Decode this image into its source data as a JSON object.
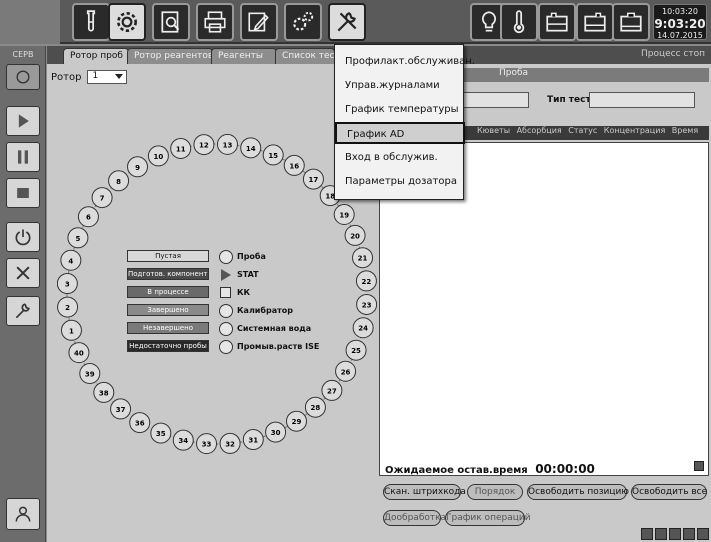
{
  "clock": {
    "top": "10:03:20",
    "time": "9:03:20",
    "date": "14.07.2015"
  },
  "sidebar": {
    "top_label": "СЕРВ"
  },
  "tabs": [
    {
      "label": "Ротор проб"
    },
    {
      "label": "Ротор реагентов"
    },
    {
      "label": "Реагенты"
    },
    {
      "label": "Список тестов"
    }
  ],
  "tab_right_text": "Процесс стоп",
  "rotor": {
    "label": "Ротор",
    "selected": "1"
  },
  "positions": [
    "1",
    "2",
    "3",
    "4",
    "5",
    "6",
    "7",
    "8",
    "9",
    "10",
    "11",
    "12",
    "13",
    "14",
    "15",
    "16",
    "17",
    "18",
    "19",
    "20",
    "21",
    "22",
    "23",
    "24",
    "25",
    "26",
    "27",
    "28",
    "29",
    "30",
    "31",
    "32",
    "33",
    "34",
    "35",
    "36",
    "37",
    "38",
    "39",
    "40"
  ],
  "status_legend": [
    {
      "label": "Пустая",
      "color": "#d8d8d8",
      "text_color": "#111"
    },
    {
      "label": "Подготов. компоненты",
      "color": "#4a4a4a",
      "text_color": "#fff"
    },
    {
      "label": "В процессе",
      "color": "#6a6a6a",
      "text_color": "#fff"
    },
    {
      "label": "Завершено",
      "color": "#8a8a8a",
      "text_color": "#fff"
    },
    {
      "label": "Незавершено",
      "color": "#7a7a7a",
      "text_color": "#fff"
    },
    {
      "label": "Недостаточно пробы",
      "color": "#2a2a2a",
      "text_color": "#fff"
    }
  ],
  "sample_types": [
    {
      "label": "Проба",
      "icon": "circle-icon"
    },
    {
      "label": "STAT",
      "icon": "triangle-icon"
    },
    {
      "label": "КК",
      "icon": "square-icon"
    },
    {
      "label": "Калибратор",
      "icon": "circle-icon"
    },
    {
      "label": "Системная вода",
      "icon": "circle-icon"
    },
    {
      "label": "Промыв.раств ISE",
      "icon": "circle-icon"
    }
  ],
  "right_panel": {
    "header": "Проба",
    "test_type_label": "Тип теста",
    "results_columns": "Кюветы  Абсорбция  Статус  Концентрация  Время"
  },
  "expected_time": {
    "label": "Ожидаемое остав.время",
    "value": "00:00:00"
  },
  "buttons": {
    "scan_barcode": "Скан. штрихкода",
    "order": "Порядок",
    "free_position": "Освободить позицию",
    "free_all": "Освободить все",
    "rerun": "Дообработка",
    "schedule": "График операций"
  },
  "menu": {
    "items": [
      {
        "label": "Профилакт.обслуживан."
      },
      {
        "label": "Управ.журналами"
      },
      {
        "label": "График температуры"
      },
      {
        "label": "График АD"
      },
      {
        "label": "Вход в обслужив."
      },
      {
        "label": "Параметры дозатора"
      }
    ]
  }
}
